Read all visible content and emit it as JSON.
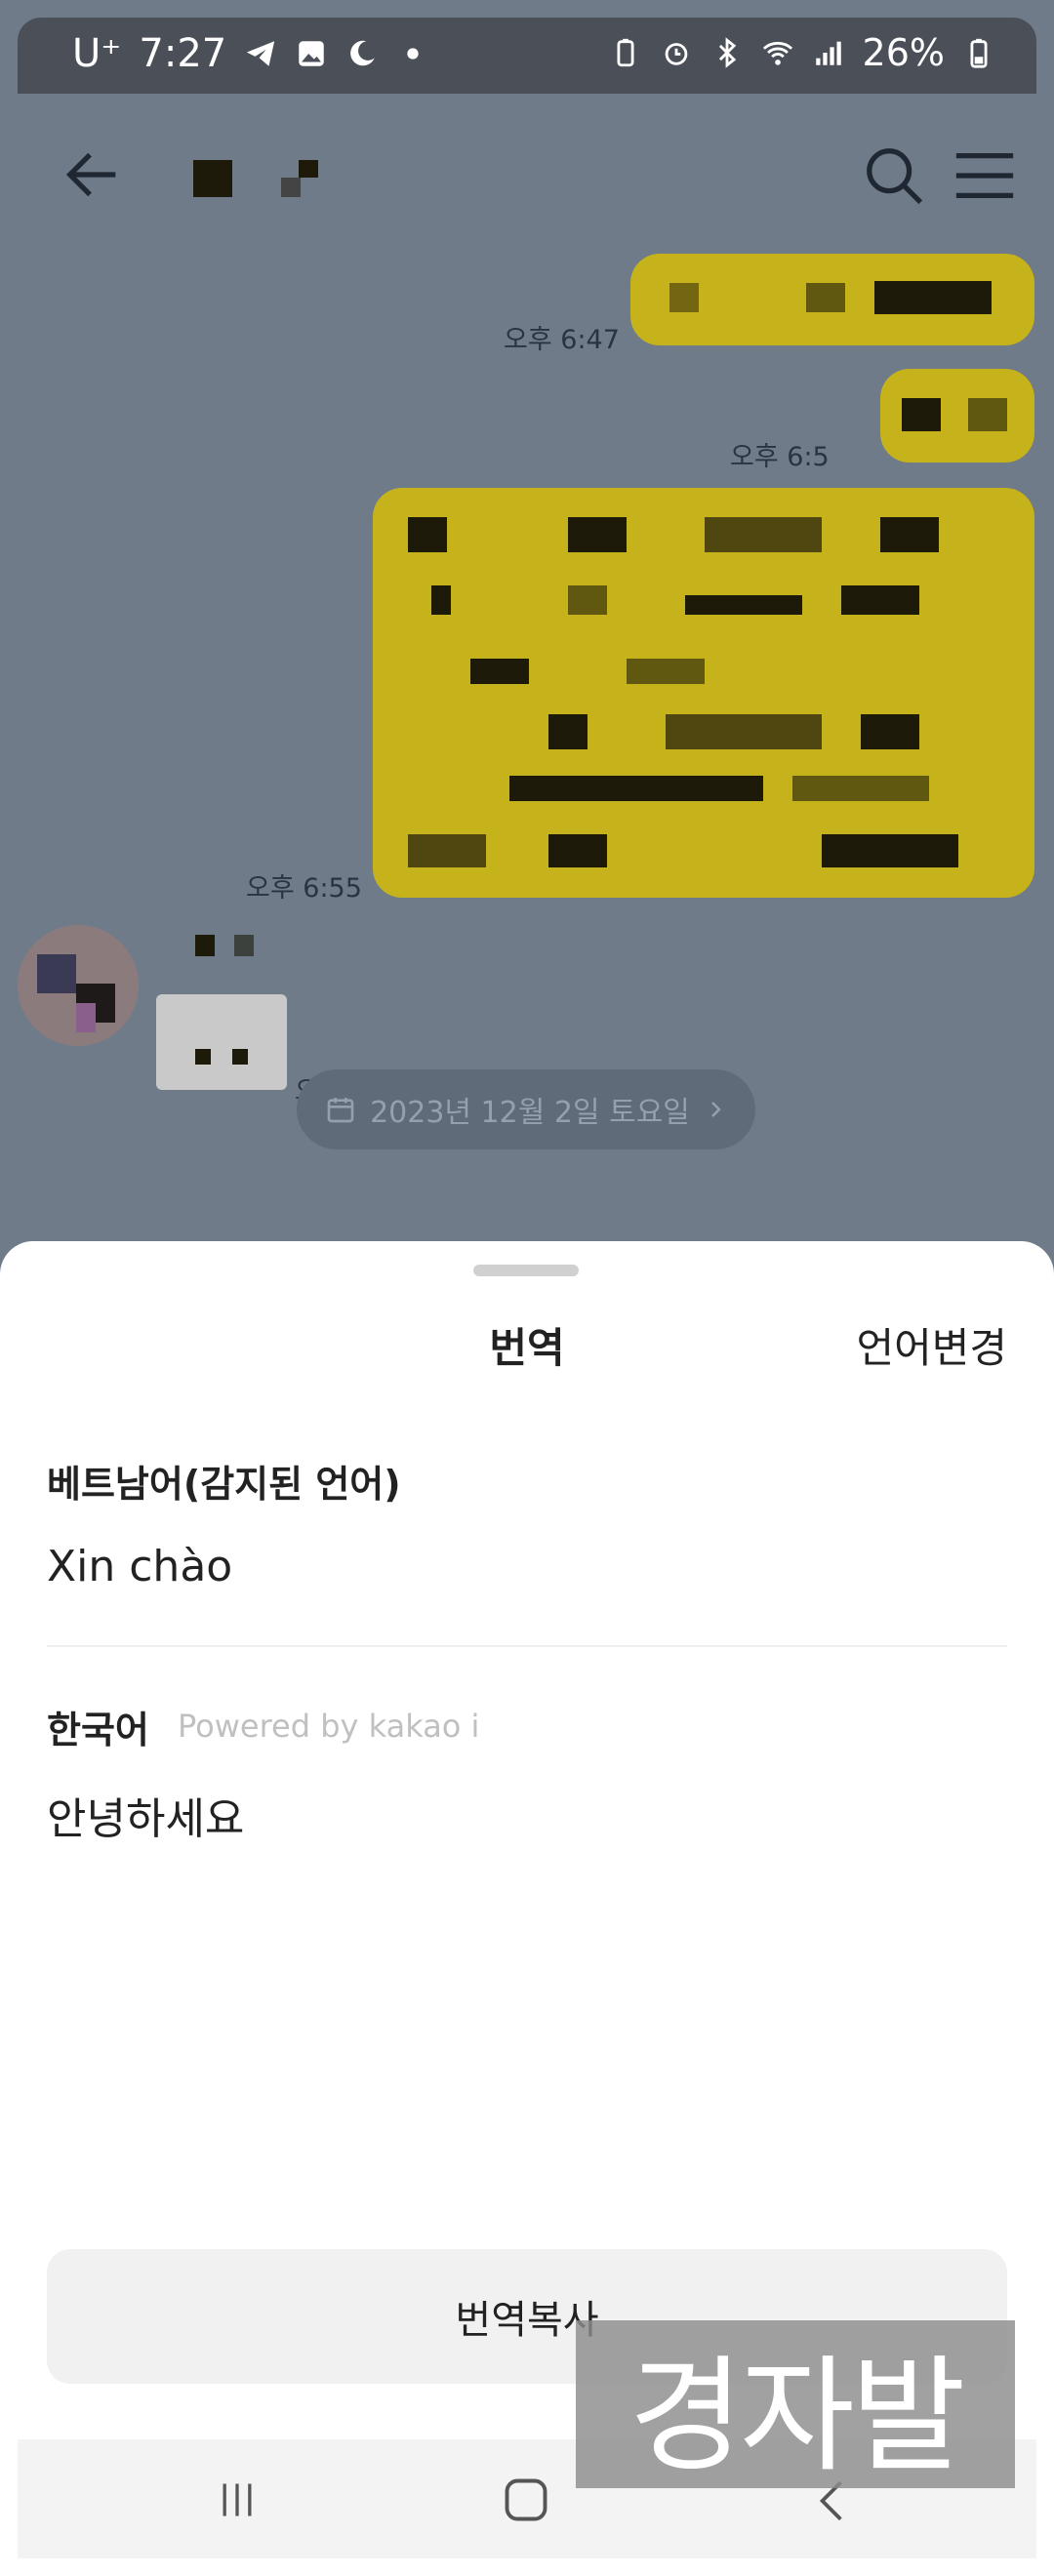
{
  "status_bar": {
    "carrier": "U⁺",
    "time": "7:27",
    "battery": "26%"
  },
  "chat": {
    "messages": [
      {
        "time": "오후 6:47"
      },
      {
        "time": "오후 6:5"
      },
      {
        "time": "오후 6:55"
      },
      {
        "time": "오후 8:10"
      }
    ],
    "date_divider": "2023년 12월 2일 토요일"
  },
  "sheet": {
    "title": "번역",
    "change_language": "언어변경",
    "source": {
      "label": "베트남어(감지된 언어)",
      "text": "Xin chào"
    },
    "target": {
      "label": "한국어",
      "powered_by": "Powered by kakao i",
      "text": "안녕하세요"
    },
    "copy_button": "번역복사"
  },
  "watermark": "경자발",
  "colors": {
    "bubble": "#c6b31b",
    "overlay": "#6f7b89",
    "sheet": "#ffffff"
  },
  "icons": [
    "back-arrow-icon",
    "search-icon",
    "menu-icon",
    "calendar-icon",
    "chevron-right-icon",
    "recent-apps-icon",
    "home-icon",
    "nav-back-icon"
  ]
}
